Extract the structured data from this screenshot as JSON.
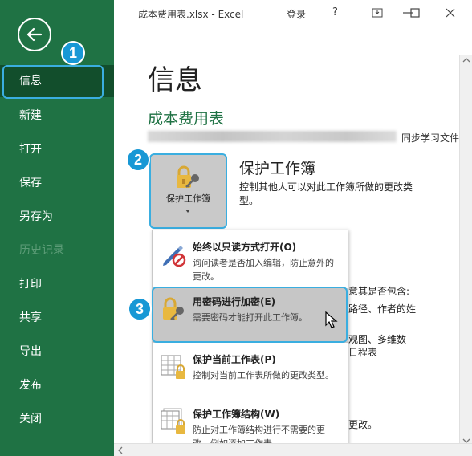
{
  "window": {
    "title": "成本费用表.xlsx  -  Excel",
    "login": "登录",
    "help": "?"
  },
  "sidebar": {
    "items": [
      {
        "label": "信息"
      },
      {
        "label": "新建"
      },
      {
        "label": "打开"
      },
      {
        "label": "保存"
      },
      {
        "label": "另存为"
      },
      {
        "label": "历史记录"
      },
      {
        "label": "打印"
      },
      {
        "label": "共享"
      },
      {
        "label": "导出"
      },
      {
        "label": "发布"
      },
      {
        "label": "关闭"
      }
    ]
  },
  "callouts": [
    "1",
    "2",
    "3"
  ],
  "main": {
    "page_title": "信息",
    "file_name": "成本费用表",
    "sync_text": "同步学习文件",
    "protect": {
      "button_label": "保护工作簿",
      "heading": "保护工作簿",
      "description": "控制其他人可以对此工作簿所做的更改类型。"
    },
    "background_fragments": [
      "意其是否包含:",
      "路径、作者的姓",
      "观图、多维数",
      "日程表",
      "更改。"
    ]
  },
  "menu": {
    "items": [
      {
        "title": "始终以只读方式打开(O)",
        "desc": "询问读者是否加入编辑，防止意外的更改。",
        "icon": "pencil-no-icon"
      },
      {
        "title": "用密码进行加密(E)",
        "desc": "需要密码才能打开此工作簿。",
        "icon": "key-lock-icon"
      },
      {
        "title": "保护当前工作表(P)",
        "desc": "控制对当前工作表所做的更改类型。",
        "icon": "sheet-lock-icon"
      },
      {
        "title": "保护工作簿结构(W)",
        "desc": "防止对工作簿结构进行不需要的更改，例如添加工作表。",
        "icon": "workbook-lock-icon"
      }
    ]
  },
  "colors": {
    "sidebar": "#1f7244",
    "sidebar_active": "#124e2c",
    "accent": "#1f7244",
    "callout": "#1898d5",
    "highlight_border": "#3aaee0"
  }
}
